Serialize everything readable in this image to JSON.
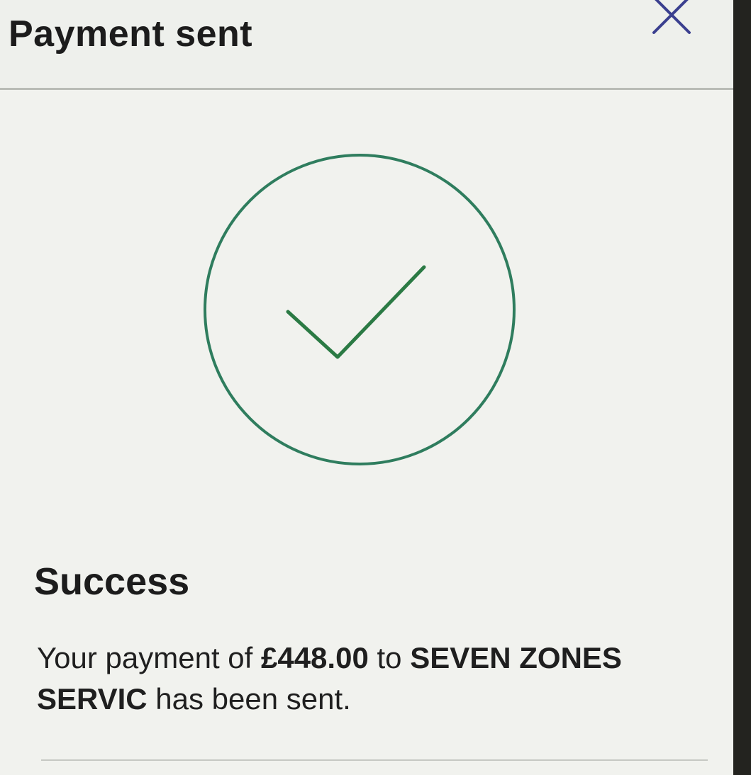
{
  "header": {
    "title": "Payment sent",
    "close_icon": "close-icon"
  },
  "status": {
    "icon": "check-circle-icon",
    "color": "#2f7d5e",
    "heading": "Success"
  },
  "message": {
    "prefix": "Your payment of ",
    "amount": "£448.00",
    "middle": " to ",
    "recipient": "SEVEN ZONES SERVIC",
    "suffix": " has been sent."
  }
}
